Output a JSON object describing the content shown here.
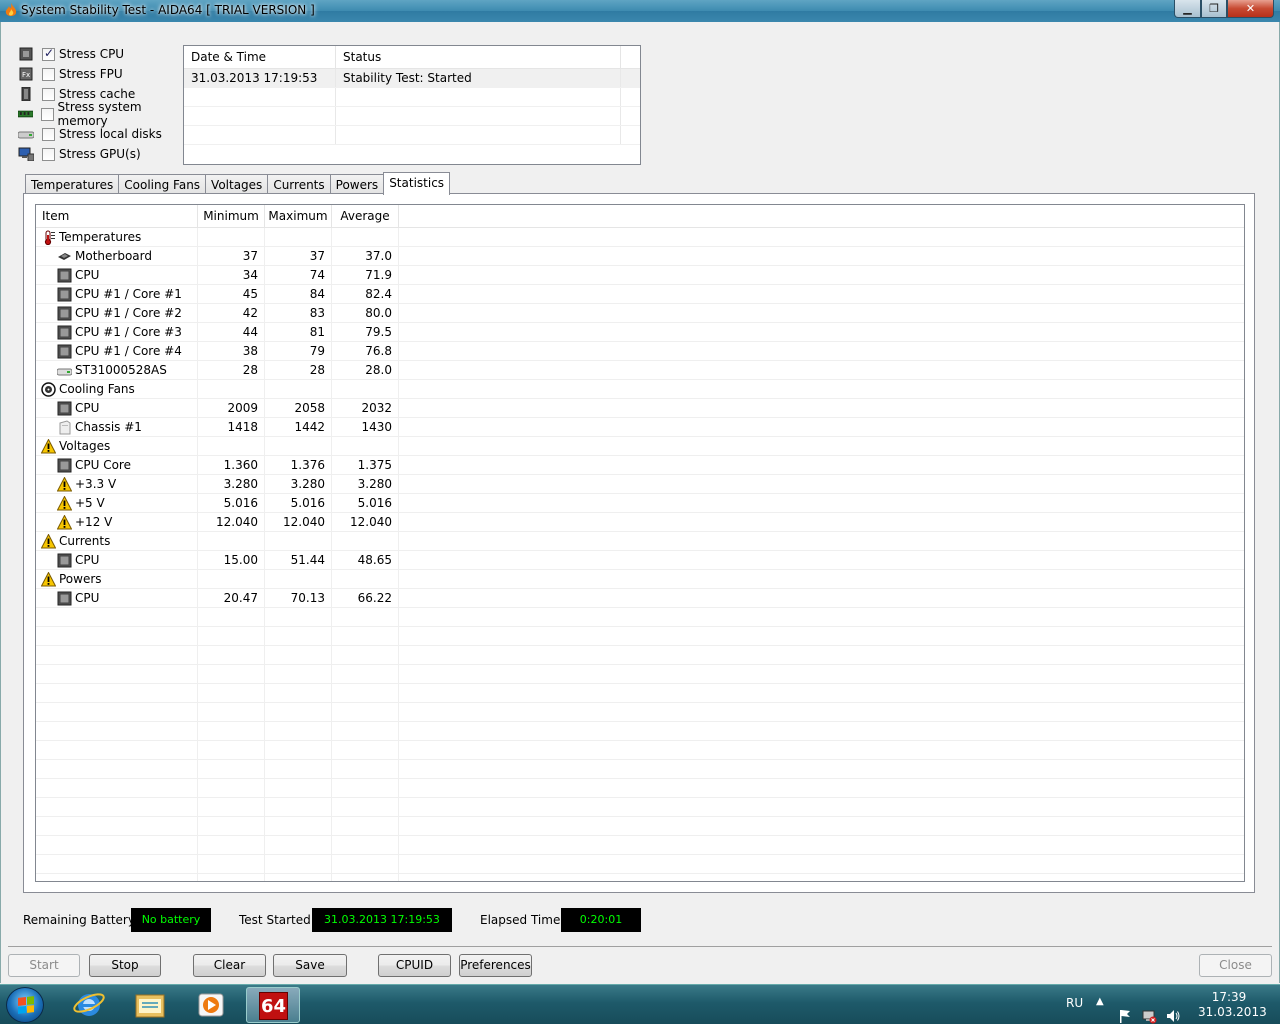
{
  "window": {
    "title": "System Stability Test - AIDA64  [ TRIAL VERSION ]"
  },
  "stress": [
    {
      "label": "Stress CPU",
      "checked": true,
      "icon": "cpu-chip-icon"
    },
    {
      "label": "Stress FPU",
      "checked": false,
      "icon": "fpu-chip-icon"
    },
    {
      "label": "Stress cache",
      "checked": false,
      "icon": "cache-chip-icon"
    },
    {
      "label": "Stress system memory",
      "checked": false,
      "icon": "memory-module-icon"
    },
    {
      "label": "Stress local disks",
      "checked": false,
      "icon": "hard-disk-icon"
    },
    {
      "label": "Stress GPU(s)",
      "checked": false,
      "icon": "monitor-icon"
    }
  ],
  "log": {
    "headers": {
      "datetime": "Date & Time",
      "status": "Status"
    },
    "rows": [
      {
        "datetime": "31.03.2013 17:19:53",
        "status": "Stability Test: Started"
      }
    ]
  },
  "tabs": [
    {
      "label": "Temperatures",
      "active": false
    },
    {
      "label": "Cooling Fans",
      "active": false
    },
    {
      "label": "Voltages",
      "active": false
    },
    {
      "label": "Currents",
      "active": false
    },
    {
      "label": "Powers",
      "active": false
    },
    {
      "label": "Statistics",
      "active": true
    }
  ],
  "stats": {
    "headers": {
      "item": "Item",
      "min": "Minimum",
      "max": "Maximum",
      "avg": "Average"
    },
    "rows": [
      {
        "item": "Temperatures",
        "group": true,
        "icon": "thermometer-icon"
      },
      {
        "item": "Motherboard",
        "min": "37",
        "max": "37",
        "avg": "37.0",
        "icon": "motherboard-icon"
      },
      {
        "item": "CPU",
        "min": "34",
        "max": "74",
        "avg": "71.9",
        "icon": "cpu-chip-icon"
      },
      {
        "item": "CPU #1 / Core #1",
        "min": "45",
        "max": "84",
        "avg": "82.4",
        "icon": "cpu-chip-icon"
      },
      {
        "item": "CPU #1 / Core #2",
        "min": "42",
        "max": "83",
        "avg": "80.0",
        "icon": "cpu-chip-icon"
      },
      {
        "item": "CPU #1 / Core #3",
        "min": "44",
        "max": "81",
        "avg": "79.5",
        "icon": "cpu-chip-icon"
      },
      {
        "item": "CPU #1 / Core #4",
        "min": "38",
        "max": "79",
        "avg": "76.8",
        "icon": "cpu-chip-icon"
      },
      {
        "item": "ST31000528AS",
        "min": "28",
        "max": "28",
        "avg": "28.0",
        "icon": "hard-disk-icon"
      },
      {
        "item": "Cooling Fans",
        "group": true,
        "icon": "fan-icon"
      },
      {
        "item": "CPU",
        "min": "2009",
        "max": "2058",
        "avg": "2032",
        "icon": "cpu-chip-icon"
      },
      {
        "item": "Chassis #1",
        "min": "1418",
        "max": "1442",
        "avg": "1430",
        "icon": "chassis-icon"
      },
      {
        "item": "Voltages",
        "group": true,
        "icon": "warning-icon"
      },
      {
        "item": "CPU Core",
        "min": "1.360",
        "max": "1.376",
        "avg": "1.375",
        "icon": "cpu-chip-icon"
      },
      {
        "item": "+3.3 V",
        "min": "3.280",
        "max": "3.280",
        "avg": "3.280",
        "icon": "warning-icon"
      },
      {
        "item": "+5 V",
        "min": "5.016",
        "max": "5.016",
        "avg": "5.016",
        "icon": "warning-icon"
      },
      {
        "item": "+12 V",
        "min": "12.040",
        "max": "12.040",
        "avg": "12.040",
        "icon": "warning-icon"
      },
      {
        "item": "Currents",
        "group": true,
        "icon": "warning-icon"
      },
      {
        "item": "CPU",
        "min": "15.00",
        "max": "51.44",
        "avg": "48.65",
        "icon": "cpu-chip-icon"
      },
      {
        "item": "Powers",
        "group": true,
        "icon": "warning-icon"
      },
      {
        "item": "CPU",
        "min": "20.47",
        "max": "70.13",
        "avg": "66.22",
        "icon": "cpu-chip-icon"
      }
    ]
  },
  "status": {
    "battery_label": "Remaining Battery:",
    "battery_value": "No battery",
    "started_label": "Test Started:",
    "started_value": "31.03.2013 17:19:53",
    "elapsed_label": "Elapsed Time:",
    "elapsed_value": "0:20:01"
  },
  "buttons": {
    "start": "Start",
    "stop": "Stop",
    "clear": "Clear",
    "save": "Save",
    "cpuid": "CPUID",
    "preferences": "Preferences",
    "close": "Close"
  },
  "taskbar": {
    "lang": "RU",
    "time": "17:39",
    "date": "31.03.2013",
    "aida_label": "64"
  },
  "colors": {
    "lcd_bg": "#000000",
    "lcd_fg": "#00ff00",
    "taskbar": "#1e5a6a"
  }
}
